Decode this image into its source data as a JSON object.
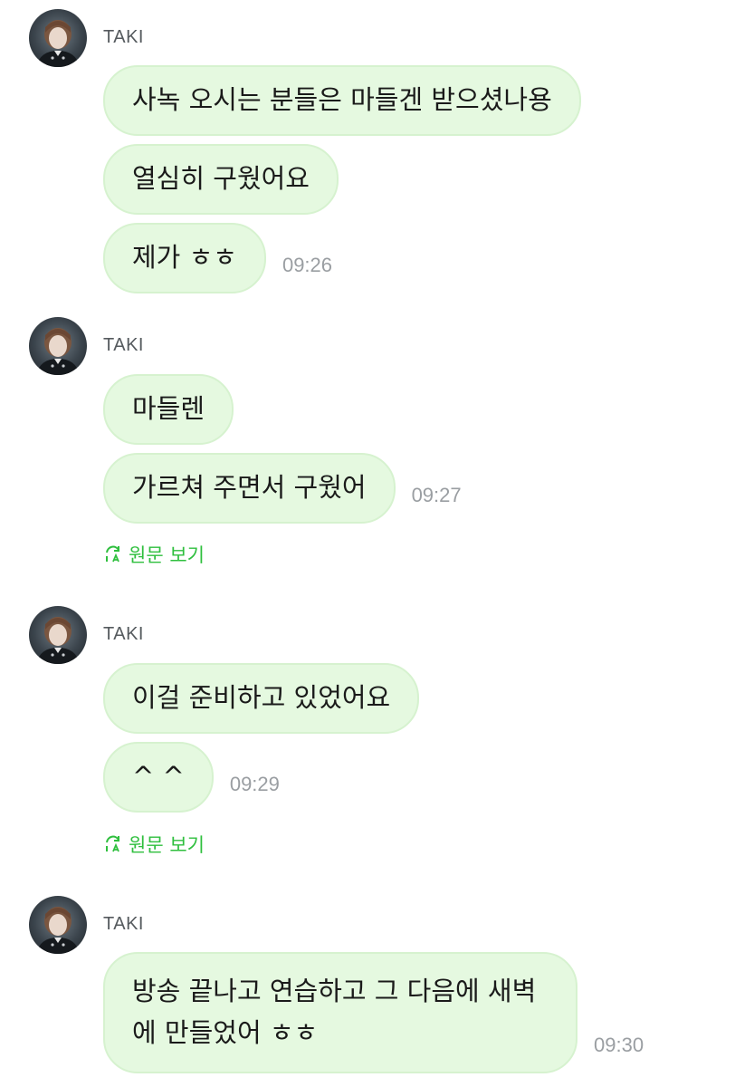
{
  "messages": [
    {
      "sender": "TAKI",
      "bubbles": [
        "사녹 오시는 분들은 마들겐 받으셨나용",
        "열심히 구웠어요",
        "제가 ㅎㅎ"
      ],
      "time": "09:26"
    },
    {
      "sender": "TAKI",
      "bubbles": [
        "마들렌",
        "가르쳐 주면서 구웠어"
      ],
      "time": "09:27",
      "original_link": "원문 보기"
    },
    {
      "sender": "TAKI",
      "bubbles": [
        "이걸 준비하고 있었어요",
        "^ ^"
      ],
      "time": "09:29",
      "original_link": "원문 보기"
    },
    {
      "sender": "TAKI",
      "bubbles": [
        "방송 끝나고 연습하고 그 다음에 새벽에 만들었어 ㅎㅎ"
      ],
      "time": "09:30"
    }
  ],
  "colors": {
    "bubble_bg": "#e5f9e0",
    "bubble_border": "#d6f2cf",
    "link_green": "#2fbf3e",
    "timestamp_gray": "#9a9ea2"
  },
  "icons": {
    "avatar": "profile-photo",
    "original_link": "translate-refresh-icon"
  }
}
